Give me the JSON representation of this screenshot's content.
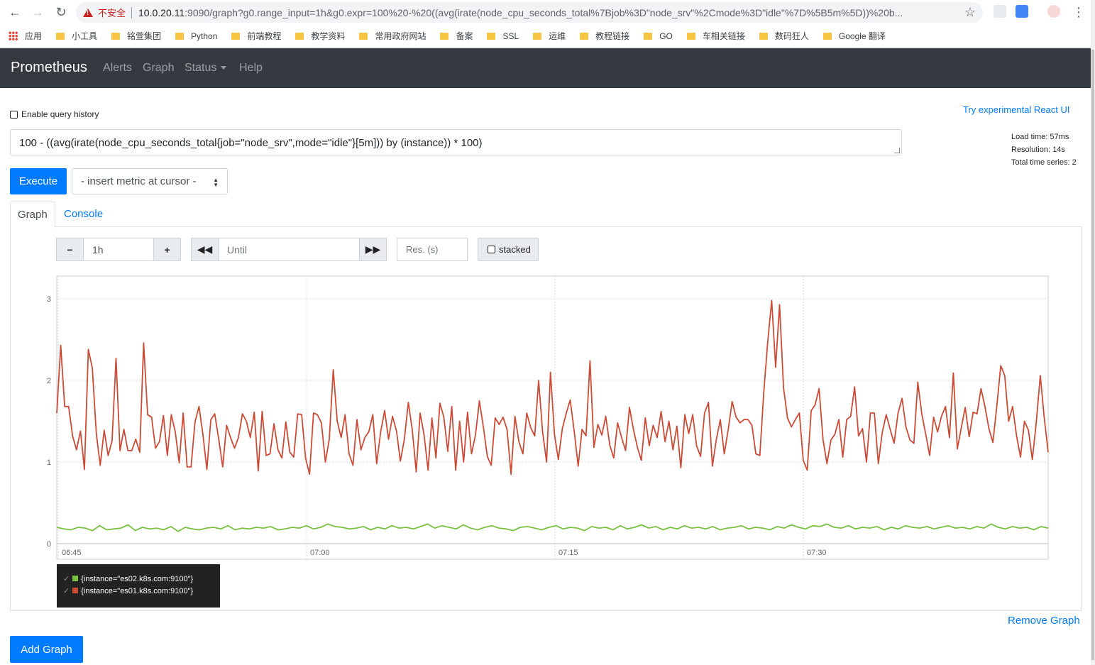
{
  "browser": {
    "insecure_label": "不安全",
    "url_host": "10.0.20.11",
    "url_rest": ":9090/graph?g0.range_input=1h&g0.expr=100%20-%20((avg(irate(node_cpu_seconds_total%7Bjob%3D\"node_srv\"%2Cmode%3D\"idle\"%7D%5B5m%5D))%20b...",
    "bookmarks": [
      "应用",
      "小工具",
      "铭萱集团",
      "Python",
      "前端教程",
      "教学资料",
      "常用政府网站",
      "备案",
      "SSL",
      "运维",
      "教程链接",
      "GO",
      "车相关链接",
      "数码狂人",
      "Google 翻译"
    ]
  },
  "navbar": {
    "brand": "Prometheus",
    "links": [
      "Alerts",
      "Graph",
      "Status",
      "Help"
    ]
  },
  "query": {
    "history_label": "Enable query history",
    "react_link": "Try experimental React UI",
    "expression": "100 - ((avg(irate(node_cpu_seconds_total{job=\"node_srv\",mode=\"idle\"}[5m])) by (instance)) * 100)",
    "execute_label": "Execute",
    "metric_select": "- insert metric at cursor -",
    "load_time": "Load time: 57ms",
    "resolution": "Resolution: 14s",
    "total_series": "Total time series: 2"
  },
  "tabs": {
    "graph": "Graph",
    "console": "Console"
  },
  "controls": {
    "range_value": "1h",
    "until_placeholder": "Until",
    "res_placeholder": "Res. (s)",
    "stacked_label": "stacked"
  },
  "actions": {
    "remove_graph": "Remove Graph",
    "add_graph": "Add Graph"
  },
  "chart_data": {
    "type": "line",
    "x_ticks": [
      "06:45",
      "07:00",
      "07:15",
      "07:30"
    ],
    "y_ticks": [
      "0",
      "1",
      "2",
      "3"
    ],
    "ylim": [
      0,
      3.2
    ],
    "grid": true,
    "legend_placement": "bottom-left",
    "series": [
      {
        "name": "{instance=\"es02.k8s.com:9100\"}",
        "color": "#7ac143",
        "values": [
          0.2,
          0.18,
          0.17,
          0.2,
          0.19,
          0.16,
          0.22,
          0.17,
          0.18,
          0.19,
          0.23,
          0.16,
          0.2,
          0.18,
          0.19,
          0.17,
          0.21,
          0.15,
          0.2,
          0.18,
          0.17,
          0.19,
          0.2,
          0.18,
          0.22,
          0.17,
          0.19,
          0.18,
          0.2,
          0.19,
          0.21,
          0.17,
          0.18,
          0.2,
          0.19,
          0.22,
          0.18,
          0.2,
          0.24,
          0.21,
          0.2,
          0.18,
          0.19,
          0.21,
          0.17,
          0.2,
          0.18,
          0.22,
          0.19,
          0.2,
          0.18,
          0.21,
          0.24,
          0.19,
          0.22,
          0.2,
          0.18,
          0.23,
          0.19,
          0.17,
          0.2,
          0.22,
          0.19,
          0.18,
          0.16,
          0.2,
          0.21,
          0.19,
          0.17,
          0.2,
          0.22,
          0.18,
          0.2,
          0.19,
          0.16,
          0.21,
          0.19,
          0.2,
          0.17,
          0.22,
          0.18,
          0.2,
          0.23,
          0.19,
          0.21,
          0.17,
          0.2,
          0.18,
          0.22,
          0.19,
          0.2,
          0.18,
          0.21,
          0.17,
          0.19,
          0.2,
          0.22,
          0.18,
          0.2,
          0.19,
          0.17,
          0.21,
          0.19,
          0.23,
          0.2,
          0.18,
          0.22,
          0.21,
          0.24,
          0.2,
          0.19,
          0.22,
          0.18,
          0.2,
          0.19,
          0.21,
          0.17,
          0.2,
          0.18,
          0.22,
          0.2,
          0.19,
          0.21,
          0.18,
          0.2,
          0.22,
          0.19,
          0.2,
          0.18,
          0.21,
          0.19,
          0.24,
          0.2,
          0.18,
          0.21,
          0.19,
          0.2,
          0.17,
          0.21,
          0.19
        ]
      },
      {
        "name": "{instance=\"es01.k8s.com:9100\"}",
        "color": "#cc4b37",
        "values": [
          1.6,
          2.43,
          1.68,
          1.68,
          1.32,
          1.15,
          1.38,
          0.91,
          2.38,
          2.15,
          1.35,
          0.96,
          1.39,
          1.08,
          1.26,
          2.27,
          1.14,
          1.4,
          1.14,
          1.14,
          1.28,
          1.12,
          2.46,
          1.58,
          1.55,
          1.17,
          1.25,
          1.57,
          1.08,
          1.58,
          1.37,
          0.99,
          1.6,
          0.94,
          0.94,
          1.49,
          1.68,
          1.34,
          0.91,
          1.52,
          1.59,
          1.28,
          0.94,
          1.45,
          1.3,
          1.17,
          1.3,
          1.59,
          1.5,
          1.3,
          1.61,
          0.89,
          1.62,
          1.08,
          1.1,
          1.47,
          1.15,
          1.05,
          1.49,
          1.12,
          1.06,
          1.59,
          1.58,
          1.05,
          0.85,
          1.6,
          1.58,
          1.48,
          1.0,
          1.28,
          2.13,
          1.5,
          1.3,
          1.58,
          1.1,
          0.96,
          1.52,
          1.15,
          1.3,
          1.37,
          1.58,
          0.98,
          1.37,
          1.63,
          1.28,
          1.56,
          1.38,
          1.01,
          1.28,
          1.73,
          1.4,
          0.88,
          1.6,
          1.33,
          0.9,
          1.54,
          1.05,
          1.72,
          1.55,
          1.13,
          1.68,
          0.9,
          1.5,
          1.0,
          1.61,
          1.1,
          1.33,
          1.75,
          1.43,
          1.07,
          0.96,
          1.54,
          1.46,
          1.55,
          1.4,
          0.85,
          1.56,
          1.25,
          1.1,
          1.6,
          1.42,
          1.32,
          2.0,
          1.37,
          1.0,
          2.1,
          1.34,
          1.03,
          1.41,
          1.6,
          1.76,
          1.38,
          0.95,
          1.4,
          1.32,
          2.24,
          1.18,
          1.46,
          1.33,
          1.56,
          1.21,
          1.05,
          1.48,
          1.3,
          1.14,
          1.67,
          1.4,
          1.18,
          1.02,
          1.54,
          1.2,
          1.45,
          1.3,
          1.62,
          1.25,
          1.5,
          1.15,
          1.44,
          0.93,
          1.58,
          1.35,
          1.58,
          1.2,
          1.07,
          1.6,
          1.73,
          0.95,
          1.28,
          1.52,
          1.1,
          1.4,
          1.74,
          1.55,
          1.48,
          1.52,
          1.52,
          1.45,
          1.1,
          1.08,
          1.86,
          2.47,
          2.98,
          2.16,
          2.93,
          1.91,
          1.54,
          1.43,
          1.52,
          1.6,
          1.02,
          0.9,
          1.63,
          1.7,
          1.9,
          1.27,
          0.98,
          1.27,
          1.34,
          1.52,
          1.06,
          1.52,
          1.56,
          1.92,
          1.32,
          1.41,
          1.0,
          1.6,
          1.6,
          0.98,
          1.36,
          1.58,
          1.4,
          1.23,
          1.6,
          1.78,
          1.43,
          1.27,
          1.23,
          1.98,
          1.59,
          1.34,
          1.08,
          1.55,
          1.37,
          1.56,
          1.68,
          1.3,
          2.09,
          1.16,
          1.42,
          1.67,
          1.31,
          1.61,
          1.59,
          1.9,
          1.68,
          1.41,
          1.24,
          1.68,
          2.18,
          2.06,
          1.5,
          1.68,
          1.32,
          1.06,
          1.5,
          1.39,
          1.03,
          1.49,
          2.06,
          1.55,
          1.12
        ]
      }
    ]
  }
}
